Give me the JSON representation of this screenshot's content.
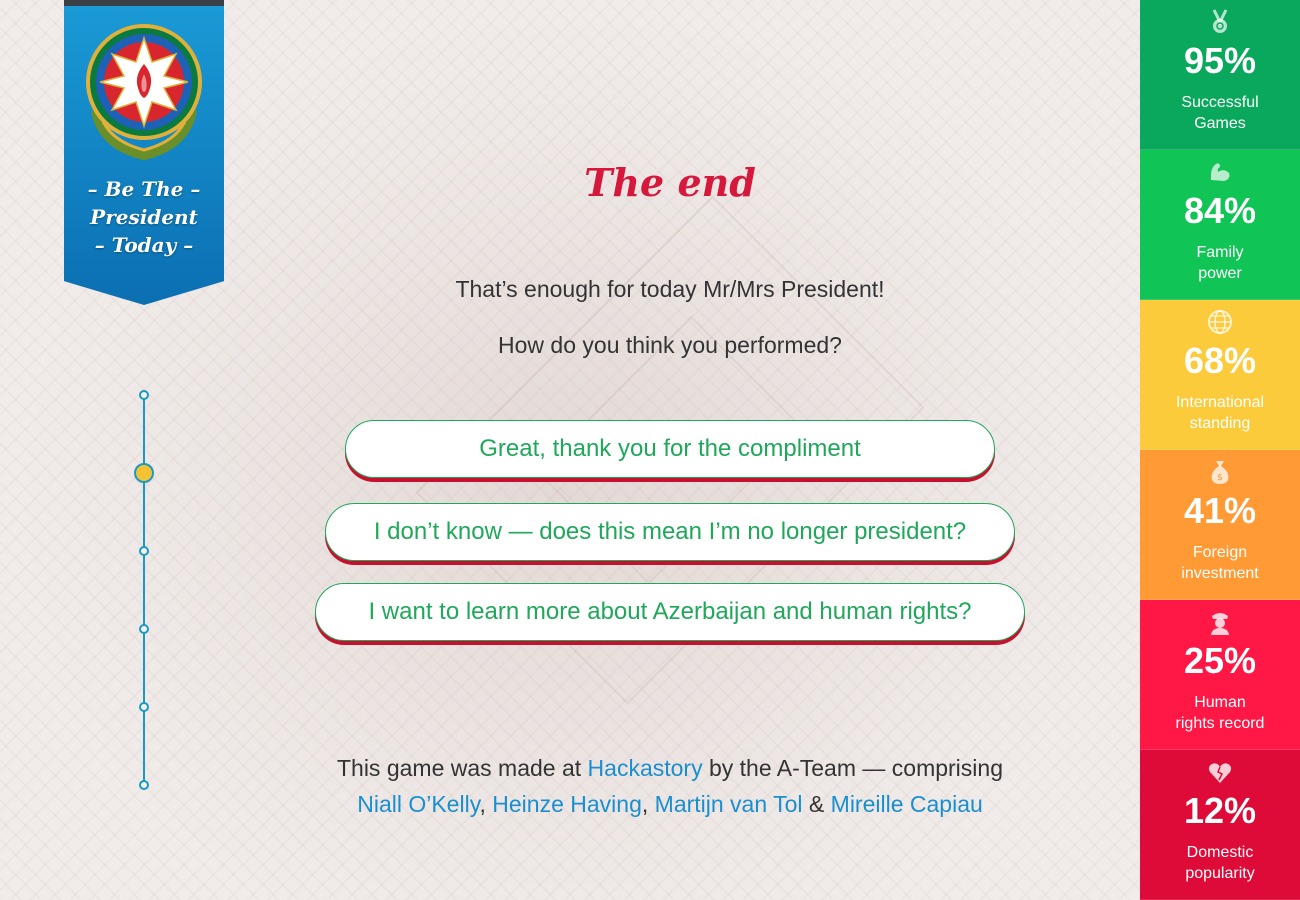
{
  "banner": {
    "title_line1": "– Be The –",
    "title_line2": "President",
    "title_line3": "– Today –"
  },
  "main": {
    "title": "The end",
    "intro_line1": "That’s enough for today Mr/Mrs President!",
    "intro_line2": "How do you think you performed?",
    "choices": [
      {
        "label": "Great, thank you for the compliment"
      },
      {
        "label": "I don’t know — does this mean I’m no longer president?"
      },
      {
        "label": "I want to learn more about Azerbaijan and human rights?"
      }
    ]
  },
  "credits": {
    "prefix": "This game was made at ",
    "hackastory": "Hackastory",
    "middle": " by the A-Team — comprising",
    "names": [
      "Niall O’Kelly",
      "Heinze Having",
      "Martijn van Tol",
      "Mireille Capiau"
    ],
    "sep_comma": ",",
    "sep_and": " & "
  },
  "timeline": {
    "steps": 6,
    "active_step": 2
  },
  "stats": [
    {
      "value": "95%",
      "label_line1": "Successful",
      "label_line2": "Games",
      "color": "#0aa85c",
      "icon": "medal-icon"
    },
    {
      "value": "84%",
      "label_line1": "Family",
      "label_line2": "power",
      "color": "#11c456",
      "icon": "bicep-icon"
    },
    {
      "value": "68%",
      "label_line1": "International",
      "label_line2": "standing",
      "color": "#fbcb3b",
      "icon": "globe-icon"
    },
    {
      "value": "41%",
      "label_line1": "Foreign",
      "label_line2": "investment",
      "color": "#ff9a35",
      "icon": "money-bag-icon"
    },
    {
      "value": "25%",
      "label_line1": "Human",
      "label_line2": "rights record",
      "color": "#ff1746",
      "icon": "officer-icon"
    },
    {
      "value": "12%",
      "label_line1": "Domestic",
      "label_line2": "popularity",
      "color": "#de0a37",
      "icon": "broken-heart-icon"
    }
  ]
}
